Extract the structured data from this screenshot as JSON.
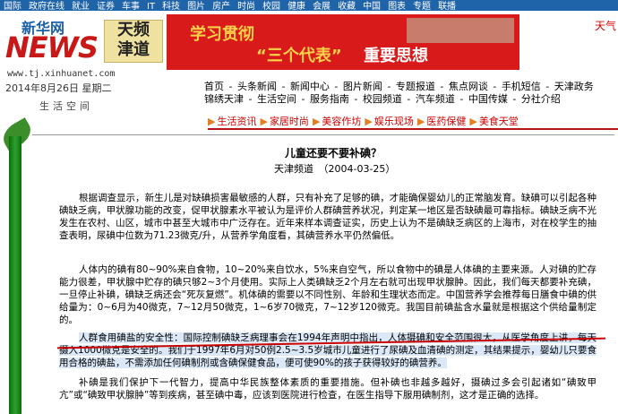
{
  "top_nav": [
    "国际",
    "政府在线",
    "就业",
    "证券",
    "车事",
    "IT",
    "科技",
    "图片",
    "房产",
    "时尚",
    "校园",
    "健康",
    "会展",
    "收藏",
    "中国",
    "图表",
    "专题",
    "联播"
  ],
  "logo": {
    "xinhua": "新华网",
    "news": "NEWS",
    "url": "www.tj.xinhuanet.com"
  },
  "channel_badge": [
    "天频",
    "津道"
  ],
  "date": "2014年8月26日 星期二",
  "banner": {
    "line1": "学习贯彻",
    "line2": "“三个代表”",
    "line3": "重要思想"
  },
  "weather_label": "天气",
  "life_space": "生活空间",
  "main_nav": {
    "row1": [
      "首页",
      "头条新闻",
      "新闻中心",
      "图片新闻",
      "专题报道",
      "焦点网谈",
      "手机短信",
      "天津政务"
    ],
    "row2": [
      "锦绣天津",
      "生活空间",
      "服务指南",
      "校园频道",
      "汽车频道",
      "中国传媒",
      "分社介绍"
    ]
  },
  "tabs": [
    "生活资讯",
    "家居时尚",
    "美容作坊",
    "娱乐现场",
    "医药保健",
    "美食天堂"
  ],
  "article": {
    "title": "儿童还要不要补碘？",
    "source_line": "天津频道　（2004-03-25）",
    "paragraphs": [
      "根据调查显示，新生儿是对缺碘损害最敏感的人群，只有补充了足够的碘，才能确保婴幼儿的正常脑发育。缺碘可以引起各种碘缺乏病，甲状腺功能的改变，促甲状腺素水平被认为是评价人群碘营养状况，判定某一地区是否缺碘最可靠指标。碘缺乏病不光发生在农村、山区，城市中甚至大城市中广泛存在。近年来样本调查证实，历史上认为不是碘缺乏病区的上海市，对在校学生的抽查表明，尿碘中位数为71.23微克/升，从营养学角度看，其碘营养水平仍然偏低。",
      "人体内的碘有80~90%来自食物，10~20%来自饮水，5%来自空气，所以食物中的碘是人体碘的主要来源。人对碘的贮存能力很差，甲状腺中贮存的碘只够2~3个月使用。实际上人类碘缺乏2个月左右就可出现甲状腺肿。因此，我们每天都要补充碘，一旦停止补碘，碘缺乏病还会“死灰复燃”。机体碘的需要以不同性别、年龄和生理状态而定。中国营养学会推荐每日膳食中碘的供给量为：0~6月为40微克，7~12月50微克，1~6岁70微克，7~12岁120微克。我国目前碘盐含水量就是根据这个供给量制定的。",
      "人群食用碘盐的安全性：国际控制碘缺乏病理事会在1994年声明中指出，人体摄碘和安全范围很大，从医学角度上讲，每天摄入1000微克是安全的。我们于1997年6月对50例2.5~3.5岁城市儿童进行了尿碘及血清碘的测定，其结果提示，婴幼儿只要食用合格的碘盐，不需添加任何碘制剂或含碘保健食品，便可使90%的孩子获得较好的碘营养。",
      "补碘是我们保护下一代智力，提高中华民族整体素质的重要措施。但补碘也非越多越好，摄碘过多会引起诸如“碘致甲亢”或“碘致甲状腺肿”等到疾病，甚至碘中毒，应该到医院进行检查，在医生指导下服用碘制剂，这才是正确的选择。"
    ]
  }
}
